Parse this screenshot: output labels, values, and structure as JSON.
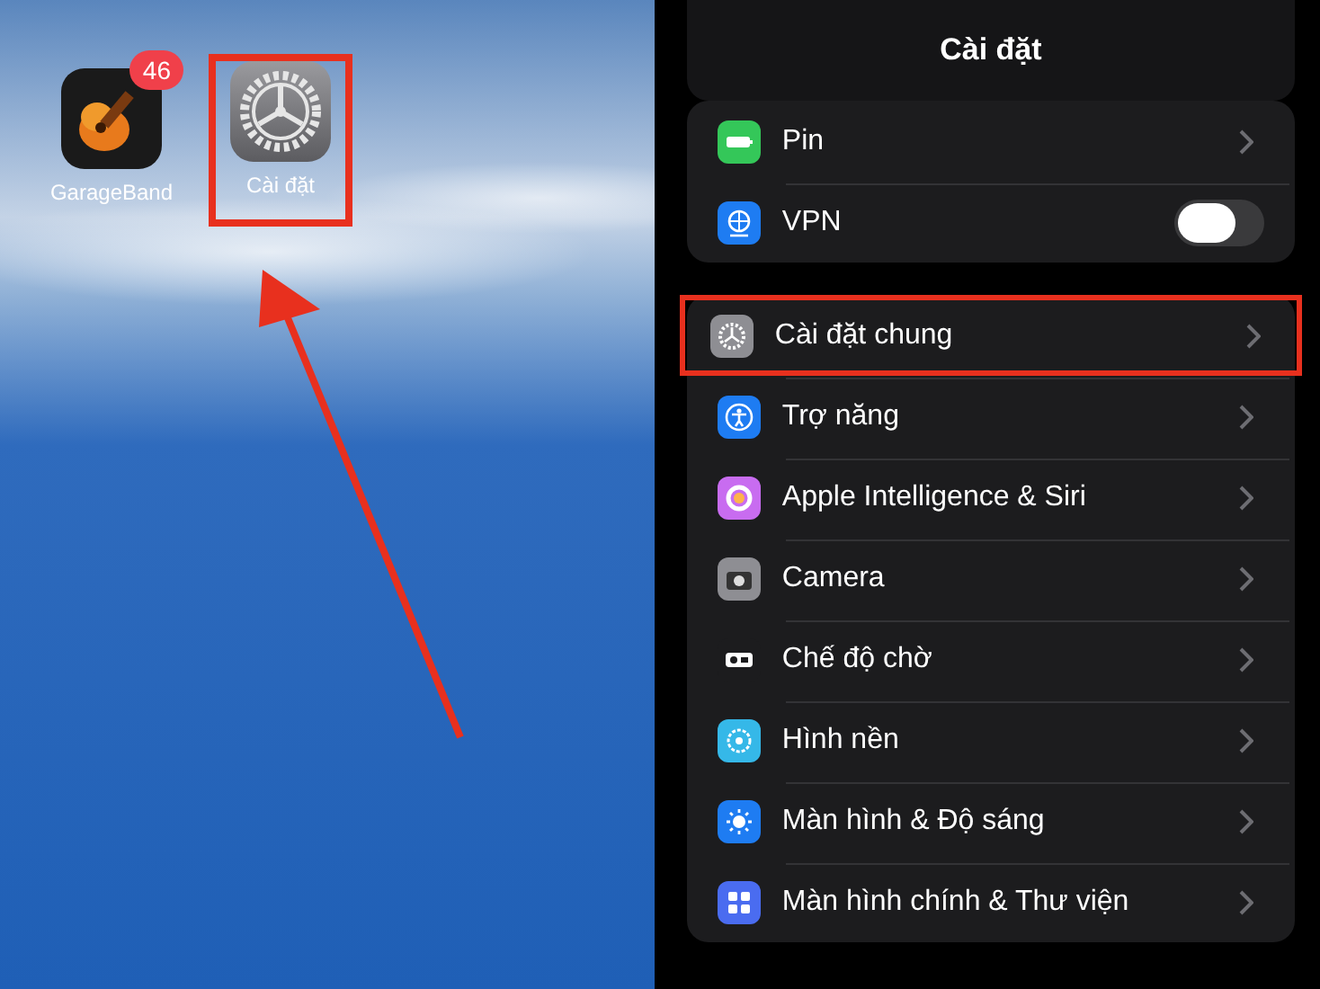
{
  "home_screen": {
    "apps": [
      {
        "label": "GarageBand",
        "badge": "46",
        "highlighted": false
      },
      {
        "label": "Cài đặt",
        "highlighted": true
      }
    ]
  },
  "settings": {
    "title": "Cài đặt",
    "groups": [
      {
        "items": [
          {
            "label": "Pin",
            "color": "#34c759",
            "kind": "link",
            "highlighted": false
          },
          {
            "label": "VPN",
            "color": "#1e7cf2",
            "kind": "toggle",
            "on": false,
            "highlighted": false
          }
        ]
      },
      {
        "items": [
          {
            "label": "Cài đặt chung",
            "color": "#8e8e93",
            "kind": "link",
            "highlighted": true
          },
          {
            "label": "Trợ năng",
            "color": "#1e7cf2",
            "kind": "link",
            "highlighted": false
          },
          {
            "label": "Apple Intelligence & Siri",
            "color": "#c86cf0",
            "kind": "link",
            "highlighted": false
          },
          {
            "label": "Camera",
            "color": "#8e8e93",
            "kind": "link",
            "highlighted": false
          },
          {
            "label": "Chế độ chờ",
            "color": "#1c1c1e",
            "kind": "link",
            "highlighted": false
          },
          {
            "label": "Hình nền",
            "color": "#35b8e8",
            "kind": "link",
            "highlighted": false
          },
          {
            "label": "Màn hình & Độ sáng",
            "color": "#1e7cf2",
            "kind": "link",
            "highlighted": false
          },
          {
            "label": "Màn hình chính & Thư viện",
            "color": "#4a6cf0",
            "kind": "link",
            "highlighted": false
          }
        ]
      }
    ]
  }
}
